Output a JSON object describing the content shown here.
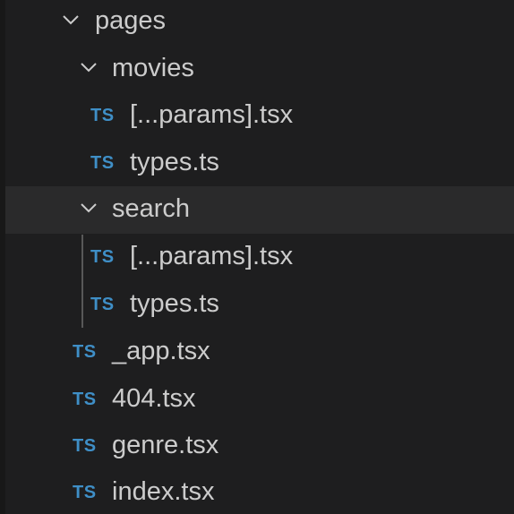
{
  "explorer": {
    "items": [
      {
        "label": "pages",
        "type": "folder",
        "expanded": true,
        "icon": "chevron-down-icon"
      },
      {
        "label": "movies",
        "type": "folder",
        "expanded": true,
        "icon": "chevron-down-icon"
      },
      {
        "label": "[...params].tsx",
        "type": "file",
        "badge": "TS",
        "icon": "typescript-icon"
      },
      {
        "label": "types.ts",
        "type": "file",
        "badge": "TS",
        "icon": "typescript-icon"
      },
      {
        "label": "search",
        "type": "folder",
        "expanded": true,
        "selected": true,
        "icon": "chevron-down-icon"
      },
      {
        "label": "[...params].tsx",
        "type": "file",
        "badge": "TS",
        "icon": "typescript-icon"
      },
      {
        "label": "types.ts",
        "type": "file",
        "badge": "TS",
        "icon": "typescript-icon"
      },
      {
        "label": "_app.tsx",
        "type": "file",
        "badge": "TS",
        "icon": "typescript-icon"
      },
      {
        "label": "404.tsx",
        "type": "file",
        "badge": "TS",
        "icon": "typescript-icon"
      },
      {
        "label": "genre.tsx",
        "type": "file",
        "badge": "TS",
        "icon": "typescript-icon"
      },
      {
        "label": "index.tsx",
        "type": "file",
        "badge": "TS",
        "icon": "typescript-icon"
      }
    ]
  },
  "colors": {
    "background": "#1e1e1f",
    "selected_row": "#2a2a2b",
    "text": "#cccccc",
    "typescript_badge": "#3f8fc7",
    "indent_guide": "#585858"
  }
}
